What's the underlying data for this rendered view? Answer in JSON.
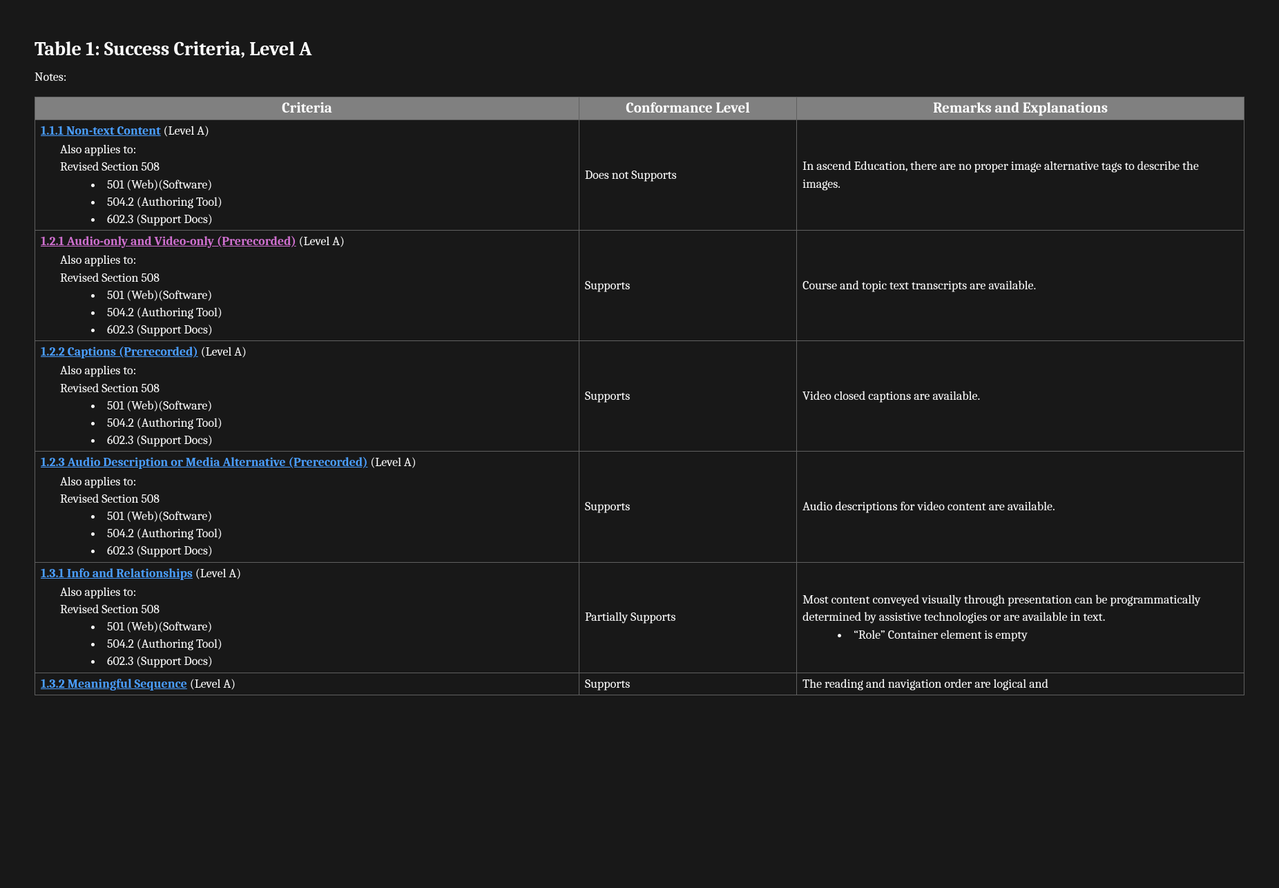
{
  "title": "Table 1: Success Criteria, Level A",
  "notes_label": "Notes:",
  "headers": {
    "criteria": "Criteria",
    "conformance": "Conformance Level",
    "remarks": "Remarks and Explanations"
  },
  "common": {
    "also_applies": "Also applies to:",
    "revised_508": "Revised Section 508",
    "sub1": "501 (Web)(Software)",
    "sub2": "504.2 (Authoring Tool)",
    "sub3": "602.3 (Support Docs)",
    "level_a": " (Level A)"
  },
  "rows": [
    {
      "num": "1.1.1",
      "link_text": "Non-text Content",
      "visited": false,
      "conformance": "Does not Supports",
      "remarks": "In ascend Education, there are no proper image alternative tags to describe the images.",
      "remarks_bullets": []
    },
    {
      "num": "1.2.1",
      "link_text": "Audio-only and Video-only (Prerecorded)",
      "visited": true,
      "conformance": "Supports",
      "remarks": "Course and topic text transcripts are available.",
      "remarks_bullets": []
    },
    {
      "num": "1.2.2",
      "link_text": "Captions (Prerecorded)",
      "visited": false,
      "conformance": "Supports",
      "remarks": "Video closed captions are available.",
      "remarks_bullets": []
    },
    {
      "num": "1.2.3",
      "link_text": "Audio Description or Media Alternative (Prerecorded)",
      "visited": false,
      "conformance": "Supports",
      "remarks": "Audio descriptions for video content are available.",
      "remarks_bullets": []
    },
    {
      "num": "1.3.1",
      "link_text": "Info and Relationships",
      "visited": false,
      "conformance": "Partially Supports",
      "remarks": "Most content conveyed visually through presentation can be programmatically determined by assistive technologies or are available in text.",
      "remarks_bullets": [
        "“Role” Container element is empty"
      ]
    },
    {
      "num": "1.3.2",
      "link_text": "Meaningful Sequence",
      "visited": false,
      "conformance": "Supports",
      "remarks": "The reading and navigation order are logical and",
      "remarks_bullets": [],
      "truncated": true
    }
  ]
}
